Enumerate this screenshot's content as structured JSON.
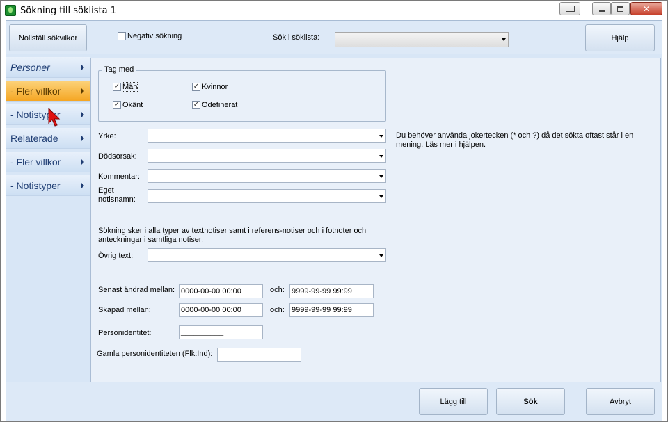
{
  "window": {
    "title": "Sökning till söklista 1"
  },
  "toolbar": {
    "reset_label": "Nollställ sökvilkor",
    "negative_search_label": "Negativ sökning",
    "negative_search_checked": false,
    "search_in_list_label": "Sök i söklista:",
    "search_in_list_value": "",
    "help_label": "Hjälp"
  },
  "sidebar": {
    "items": [
      {
        "label": "Personer",
        "active": false
      },
      {
        "label": "- Fler villkor",
        "active": true
      },
      {
        "label": "- Notistyper",
        "active": false
      },
      {
        "label": "Relaterade",
        "active": false
      },
      {
        "label": "- Fler villkor",
        "active": false
      },
      {
        "label": "- Notistyper",
        "active": false
      }
    ]
  },
  "include_group": {
    "legend": "Tag med",
    "options": [
      {
        "label": "Män",
        "checked": true
      },
      {
        "label": "Kvinnor",
        "checked": true
      },
      {
        "label": "Okänt",
        "checked": true
      },
      {
        "label": "Odefinerat",
        "checked": true
      }
    ]
  },
  "fields": {
    "yrke_label": "Yrke:",
    "yrke_value": "",
    "dodsorsak_label": "Dödsorsak:",
    "dodsorsak_value": "",
    "kommentar_label": "Kommentar:",
    "kommentar_value": "",
    "eget_notisnamn_label_1": "Eget",
    "eget_notisnamn_label_2": "notisnamn:",
    "eget_notisnamn_value": "",
    "hint_text": "Du behöver använda jokertecken (* och ?) då det sökta oftast står i en mening. Läs mer i hjälpen.",
    "info_text": "Sökning sker i alla typer av textnotiser samt i referens-notiser och i fotnoter och anteckningar i samtliga notiser.",
    "ovrig_text_label": "Övrig text:",
    "ovrig_text_value": "",
    "senast_andrad_label": "Senast ändrad mellan:",
    "senast_andrad_from": "0000-00-00 00:00",
    "och_label": "och:",
    "senast_andrad_to": "9999-99-99 99:99",
    "skapad_label": "Skapad mellan:",
    "skapad_from": "0000-00-00 00:00",
    "skapad_to": "9999-99-99 99:99",
    "personidentitet_label": "Personidentitet:",
    "personidentitet_value": "__________",
    "gamla_personidentitet_label": "Gamla personidentiteten (Flk:Ind):",
    "gamla_personidentitet_value": ""
  },
  "footer": {
    "add_label": "Lägg till",
    "search_label": "Sök",
    "cancel_label": "Avbryt"
  },
  "colors": {
    "active_nav": "#f5a623",
    "panel_bg": "#e9f0f9",
    "client_bg": "#d8e6f6",
    "close_button": "#c7402b"
  }
}
